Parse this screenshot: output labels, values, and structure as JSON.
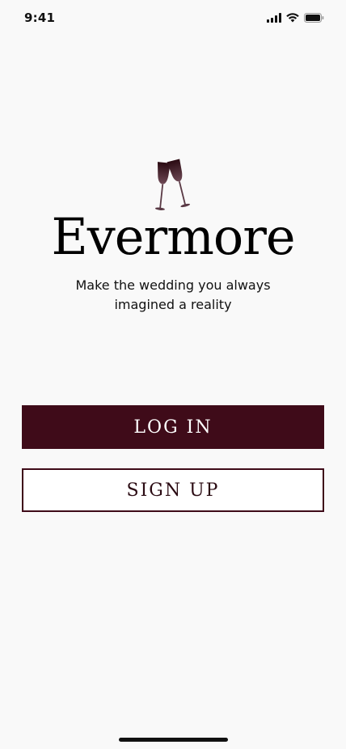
{
  "status_bar": {
    "time": "9:41",
    "icons": [
      "cellular-signal-icon",
      "wifi-icon",
      "battery-icon"
    ]
  },
  "app": {
    "title": "Evermore",
    "tagline": "Make the wedding you always imagined a reality",
    "logo_icon": "wine-glasses-icon"
  },
  "actions": {
    "login_label": "LOG IN",
    "signup_label": "SIGN UP"
  },
  "colors": {
    "background": "#f9f9f9",
    "primary": "#3f0b19",
    "text": "#111111"
  }
}
